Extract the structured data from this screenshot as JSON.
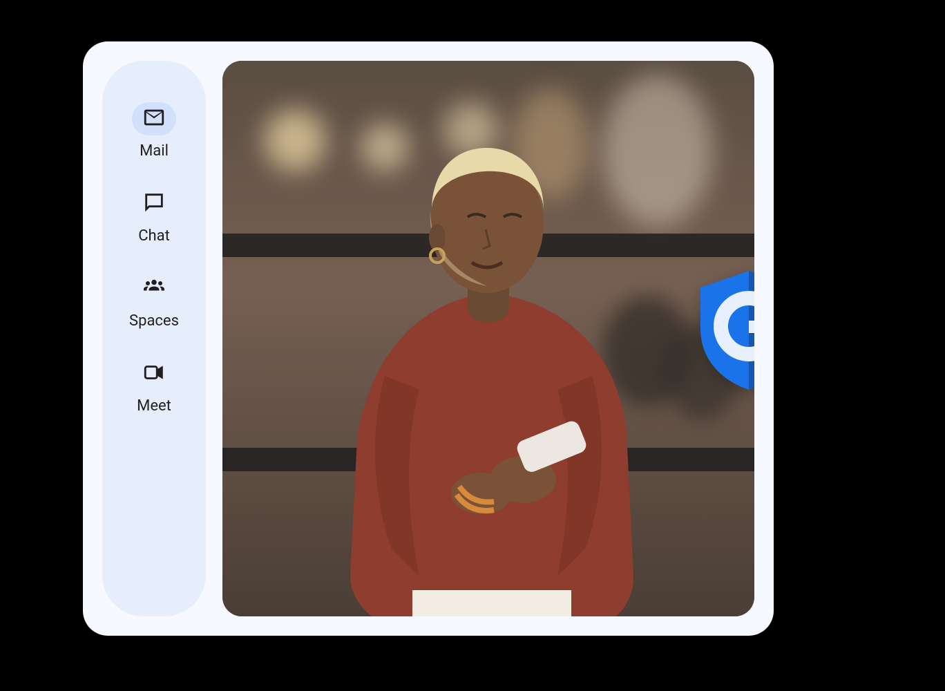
{
  "sidebar": {
    "items": [
      {
        "label": "Mail",
        "icon": "mail-icon",
        "active": true
      },
      {
        "label": "Chat",
        "icon": "chat-icon",
        "active": false
      },
      {
        "label": "Spaces",
        "icon": "people-icon",
        "active": false
      },
      {
        "label": "Meet",
        "icon": "video-icon",
        "active": false
      }
    ]
  },
  "badge": {
    "letter": "G",
    "shield_color": "#1a73e8",
    "shield_color_dark": "#1557b0"
  },
  "hero": {
    "description": "person-using-phone"
  }
}
